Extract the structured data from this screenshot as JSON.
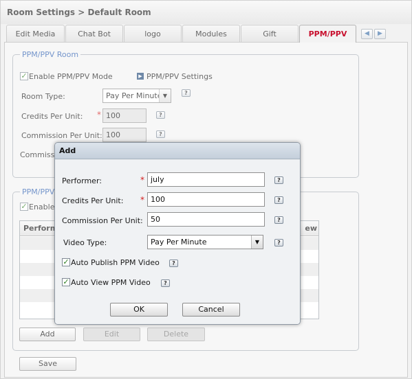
{
  "header": {
    "title": "Room Settings  > Default Room"
  },
  "tabs": [
    {
      "label": "Edit Media",
      "active": false
    },
    {
      "label": "Chat Bot",
      "active": false
    },
    {
      "label": "logo",
      "active": false
    },
    {
      "label": "Modules",
      "active": false
    },
    {
      "label": "Gift",
      "active": false
    },
    {
      "label": "PPM/PPV",
      "active": true
    }
  ],
  "tab_nav": {
    "prev_icon": "arrow-left-icon",
    "next_icon": "arrow-right-icon"
  },
  "room": {
    "legend": "PPM/PPV Room",
    "enable_label": "Enable PPM/PPV Mode",
    "enable_checked": true,
    "settings_link": "PPM/PPV Settings",
    "room_type_label": "Room Type:",
    "room_type_value": "Pay Per Minute",
    "credits_label": "Credits Per Unit:",
    "credits_value": "100",
    "commission_label": "Commission Per Unit:",
    "commission_value": "100",
    "commission2_label": "Commission"
  },
  "videos": {
    "legend": "PPM/PPV V",
    "enable_label": "Enable P",
    "enable_checked": true,
    "grid_header_left": "Performe",
    "grid_header_right": "ew",
    "add_label": "Add",
    "edit_label": "Edit",
    "delete_label": "Delete"
  },
  "save_label": "Save",
  "dialog": {
    "title": "Add",
    "performer_label": "Performer:",
    "performer_value": "july",
    "credits_label": "Credits Per Unit:",
    "credits_value": "100",
    "commission_label": "Commission Per Unit:",
    "commission_value": "50",
    "video_type_label": "Video Type:",
    "video_type_value": "Pay Per Minute",
    "auto_publish_label": "Auto Publish PPM Video",
    "auto_publish_checked": true,
    "auto_view_label": "Auto View PPM Video",
    "auto_view_checked": true,
    "ok_label": "OK",
    "cancel_label": "Cancel"
  },
  "help_glyph": "?",
  "required_glyph": "*",
  "check_glyph": "✓",
  "colors": {
    "active_tab": "#c8102e",
    "legend": "#2a5db0",
    "required": "#d41c1c"
  }
}
